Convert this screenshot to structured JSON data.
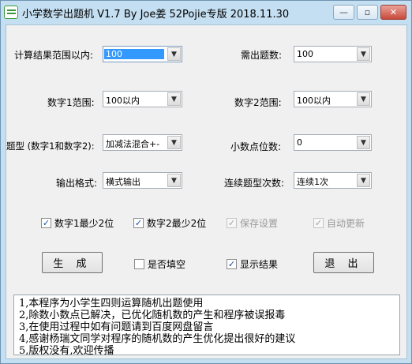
{
  "window": {
    "title": "小学数学出题机 V1.7 By Joe姜 52Pojie专版 2018.11.30",
    "min_glyph": "—",
    "max_glyph": "▫",
    "close_glyph": "✕"
  },
  "fields": {
    "result_range": {
      "label": "计算结果范围以内:",
      "value": "100"
    },
    "question_count": {
      "label": "需出题数:",
      "value": "100"
    },
    "num1_range": {
      "label": "数字1范围:",
      "value": "100以内"
    },
    "num2_range": {
      "label": "数字2范围:",
      "value": "100以内"
    },
    "question_type": {
      "label": "题型 (数字1和数字2):",
      "value": "加减法混合+-"
    },
    "decimal_places": {
      "label": "小数点位数:",
      "value": "0"
    },
    "output_format": {
      "label": "输出格式:",
      "value": "横式输出"
    },
    "consecutive_count": {
      "label": "连续题型次数:",
      "value": "连续1次"
    }
  },
  "checkboxes": {
    "num1_min2": {
      "label": "数字1最少2位",
      "checked": true
    },
    "num2_min2": {
      "label": "数字2最少2位",
      "checked": true
    },
    "save_settings": {
      "label": "保存设置",
      "checked": true
    },
    "auto_update": {
      "label": "自动更新",
      "checked": true
    },
    "fill_blank": {
      "label": "是否填空",
      "checked": false
    },
    "show_result": {
      "label": "显示结果",
      "checked": true
    }
  },
  "buttons": {
    "generate": "生 成",
    "exit": "退 出"
  },
  "notes": [
    "1,本程序为小学生四则运算随机出题使用",
    "2,除数小数点已解决，已优化随机数的产生和程序被误报毒",
    "3,在使用过程中如有问题请到百度网盘留言",
    "4,感谢杨瑞文同学对程序的随机数的产生优化提出很好的建议",
    "5,版权没有,欢迎传播"
  ],
  "icons": {
    "combo_arrow": "chevron-down-icon",
    "check": "checkmark-icon"
  }
}
